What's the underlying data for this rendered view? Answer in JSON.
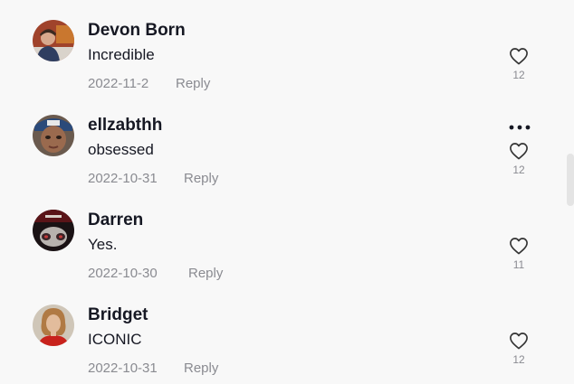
{
  "comments": [
    {
      "username": "Devon Born",
      "text": "Incredible",
      "date": "2022-11-2",
      "reply_label": "Reply",
      "likes": "12"
    },
    {
      "username": "ellzabthh",
      "text": "obsessed",
      "date": "2022-10-31",
      "reply_label": "Reply",
      "likes": "12"
    },
    {
      "username": "Darren",
      "text": "Yes.",
      "date": "2022-10-30",
      "reply_label": "Reply",
      "likes": "11"
    },
    {
      "username": "Bridget",
      "text": "ICONIC",
      "date": "2022-10-31",
      "reply_label": "Reply",
      "likes": "12"
    }
  ],
  "icons": {
    "like": "heart-outline-icon",
    "more": "more-horizontal-icon"
  },
  "colors": {
    "text": "#161823",
    "secondary": "#8a8b91",
    "background": "#f8f8f8"
  }
}
